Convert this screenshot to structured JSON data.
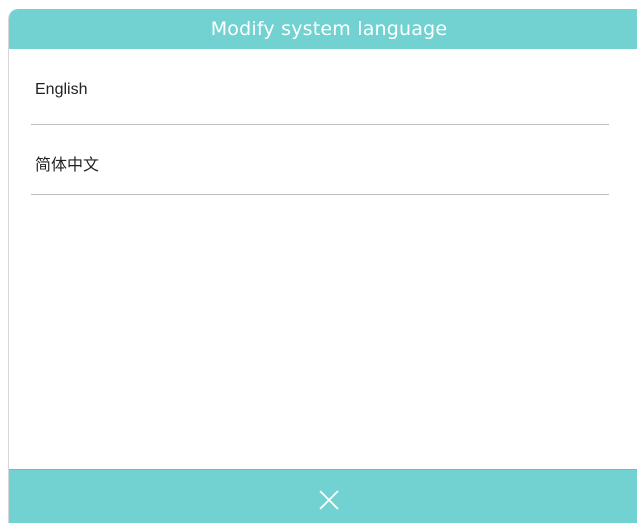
{
  "dialog": {
    "title": "Modify system language"
  },
  "languages": [
    {
      "label": "English"
    },
    {
      "label": "简体中文"
    }
  ],
  "footer": {
    "close_icon": "close-icon"
  },
  "colors": {
    "accent": "#72d1d1",
    "divider": "#bdbdbd",
    "text": "#222222"
  }
}
